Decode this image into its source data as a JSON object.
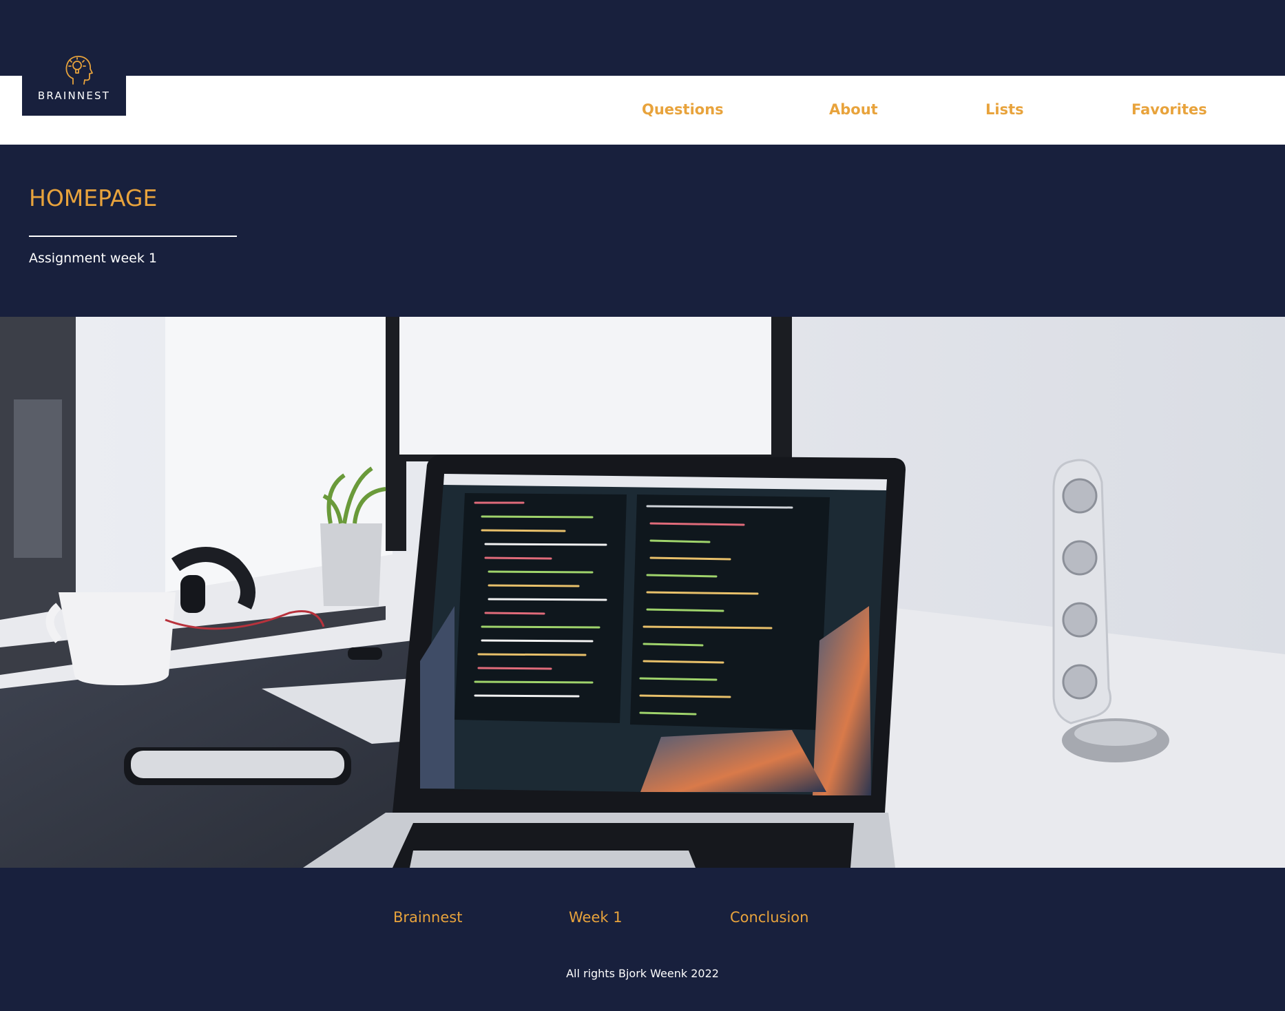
{
  "brand": {
    "logo_text": "BRAINNEST",
    "icon": "head-lightbulb-icon",
    "accent_color": "#e8a33c",
    "background_color": "#18203d"
  },
  "nav": {
    "items": [
      {
        "label": "Questions"
      },
      {
        "label": "About"
      },
      {
        "label": "Lists"
      },
      {
        "label": "Favorites"
      }
    ]
  },
  "header": {
    "title": "HOMEPAGE",
    "subtitle": "Assignment week 1"
  },
  "hero": {
    "image": "desk-laptop-code-photo"
  },
  "footer": {
    "links": [
      {
        "label": "Brainnest"
      },
      {
        "label": "Week 1"
      },
      {
        "label": "Conclusion"
      }
    ],
    "copyright": "All rights Bjork Weenk 2022"
  }
}
